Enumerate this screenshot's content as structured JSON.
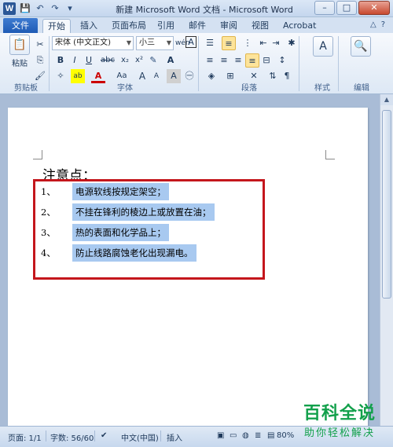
{
  "window": {
    "app_icon": "W",
    "title": "新建 Microsoft Word 文档 - Microsoft Word",
    "minimize_icon": "minimize-icon",
    "maximize_icon": "maximize-icon",
    "close_icon": "close-icon"
  },
  "qat": {
    "save": "💾",
    "undo": "↶",
    "redo": "↷",
    "customize": "▾"
  },
  "tabs": {
    "file": "文件",
    "items": [
      "开始",
      "插入",
      "页面布局",
      "引用",
      "邮件",
      "审阅",
      "视图",
      "Acrobat"
    ],
    "active": "开始"
  },
  "ribbon": {
    "clipboard": {
      "paste": "粘贴",
      "label": "剪贴板"
    },
    "font": {
      "font_name": "宋体 (中文正文)",
      "font_size": "小三",
      "grow": "A",
      "shrink": "A",
      "phonetic": "wén",
      "border": "A",
      "bold": "B",
      "italic": "I",
      "underline": "U",
      "strike": "abc",
      "sub": "x₂",
      "sup": "x²",
      "highlight": "ab",
      "color": "A",
      "case": "Aa",
      "grow2": "A",
      "shrink2": "A",
      "char_shade": "A",
      "enclose": "㊀",
      "label": "字体"
    },
    "paragraph": {
      "label": "段落"
    },
    "style": {
      "label": "样式"
    },
    "editing": {
      "label": "编辑"
    }
  },
  "document": {
    "heading": "注意点：",
    "items": [
      {
        "num": "1、",
        "text": "电源软线按规定架空；"
      },
      {
        "num": "2、",
        "text": "不挂在锋利的棱边上或放置在油；"
      },
      {
        "num": "3、",
        "text": "热的表面和化学品上；"
      },
      {
        "num": "4、",
        "text": "防止线路腐蚀老化出现漏电。"
      }
    ]
  },
  "status": {
    "page": "页面: 1/1",
    "words": "字数: 56/60",
    "lang": "中文(中国)",
    "insert": "插入",
    "zoom": "80%"
  },
  "watermark": {
    "main": "百科全说",
    "sub": "助你轻松解决"
  }
}
